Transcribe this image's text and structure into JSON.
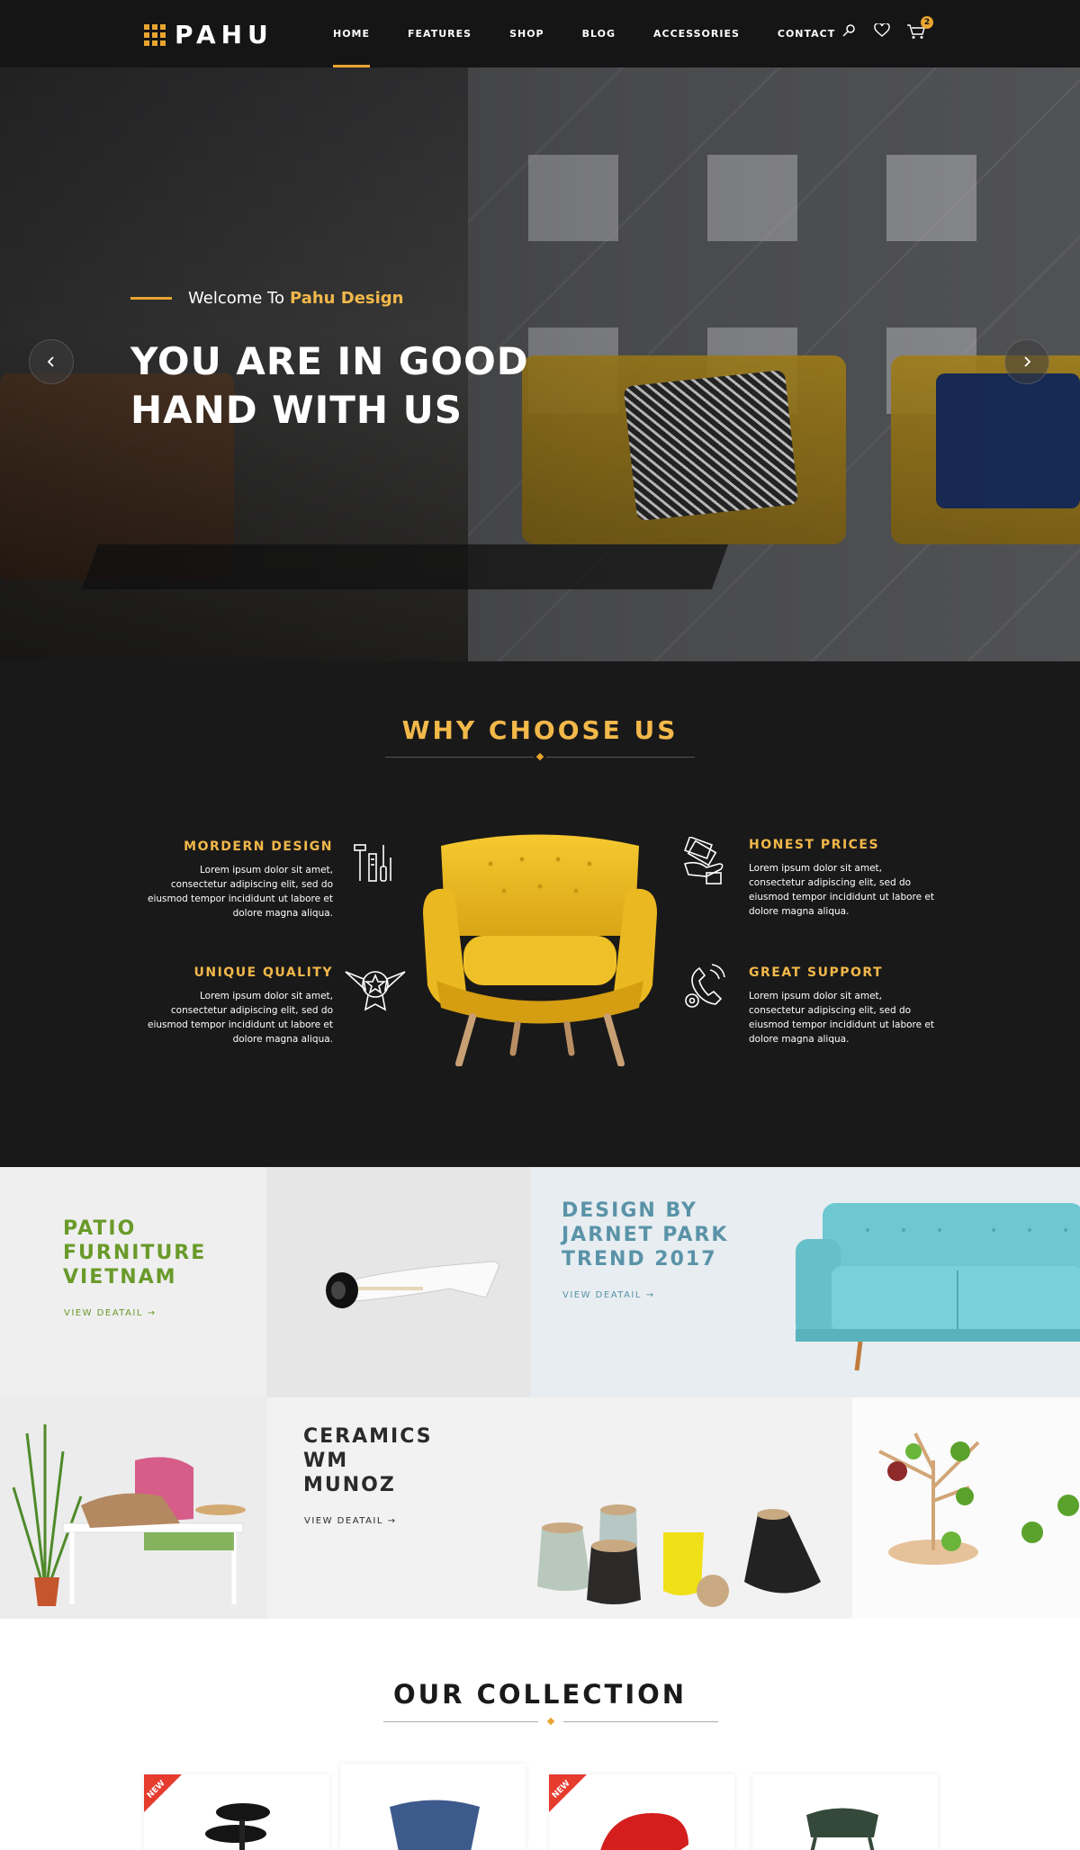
{
  "header": {
    "logo_text": "PAHU",
    "nav": [
      "HOME",
      "FEATURES",
      "SHOP",
      "BLOG",
      "ACCESSORIES",
      "CONTACT"
    ],
    "active_nav": "HOME",
    "cart_count": "2"
  },
  "hero": {
    "welcome_prefix": "Welcome To",
    "welcome_brand": "Pahu Design",
    "title_line1": "YOU ARE IN GOOD",
    "title_line2": "HAND WITH US"
  },
  "why": {
    "title": "WHY CHOOSE US",
    "features": [
      {
        "title": "MORDERN DESIGN",
        "desc": "Lorem ipsum dolor sit amet, consectetur adipiscing elit, sed do eiusmod tempor incididunt ut labore et dolore magna aliqua.",
        "icon": "tools-icon"
      },
      {
        "title": "UNIQUE QUALITY",
        "desc": "Lorem ipsum dolor sit amet, consectetur adipiscing elit, sed do eiusmod tempor incididunt ut labore et dolore magna aliqua.",
        "icon": "quality-badge-icon"
      },
      {
        "title": "HONEST PRICES",
        "desc": "Lorem ipsum dolor sit amet, consectetur adipiscing elit, sed do eiusmod tempor incididunt ut labore et dolore magna aliqua.",
        "icon": "money-hand-icon"
      },
      {
        "title": "GREAT SUPPORT",
        "desc": "Lorem ipsum dolor sit amet, consectetur adipiscing elit, sed do eiusmod tempor incididunt ut labore et dolore magna aliqua.",
        "icon": "support-icon"
      }
    ]
  },
  "banners": [
    {
      "title_lines": [
        "PATIO",
        "FURNITURE",
        "VIETNAM"
      ],
      "link": "VIEW DEATAIL →",
      "color": "#6a9a2a"
    },
    {
      "title_lines": [
        "DESIGN BY",
        "JARNET PARK",
        "TREND 2017"
      ],
      "link": "VIEW DEATAIL →",
      "color": "#5a93a8"
    },
    {
      "title_lines": [
        "CERAMICS",
        "WM",
        "MUNOZ"
      ],
      "link": "VIEW DEATAIL →",
      "color": "#2a2a2a"
    }
  ],
  "collection": {
    "title": "OUR COLLECTION",
    "new_label": "NEW"
  },
  "colors": {
    "accent": "#e8a530",
    "dark": "#1a1919",
    "badge_red": "#e53c2e"
  }
}
